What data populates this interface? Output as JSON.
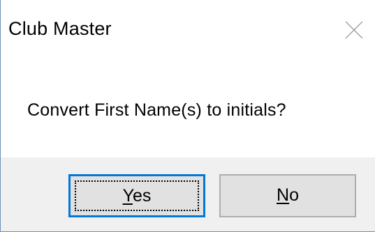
{
  "dialog": {
    "title": "Club Master",
    "message": "Convert First Name(s) to initials?",
    "close_icon": "close-icon",
    "buttons": {
      "yes": {
        "mnemonic": "Y",
        "rest": "es"
      },
      "no": {
        "mnemonic": "N",
        "rest": "o"
      }
    }
  },
  "colors": {
    "footer_bg": "#f0f0f0",
    "button_bg": "#e1e1e1",
    "focus_border": "#0078d7"
  }
}
